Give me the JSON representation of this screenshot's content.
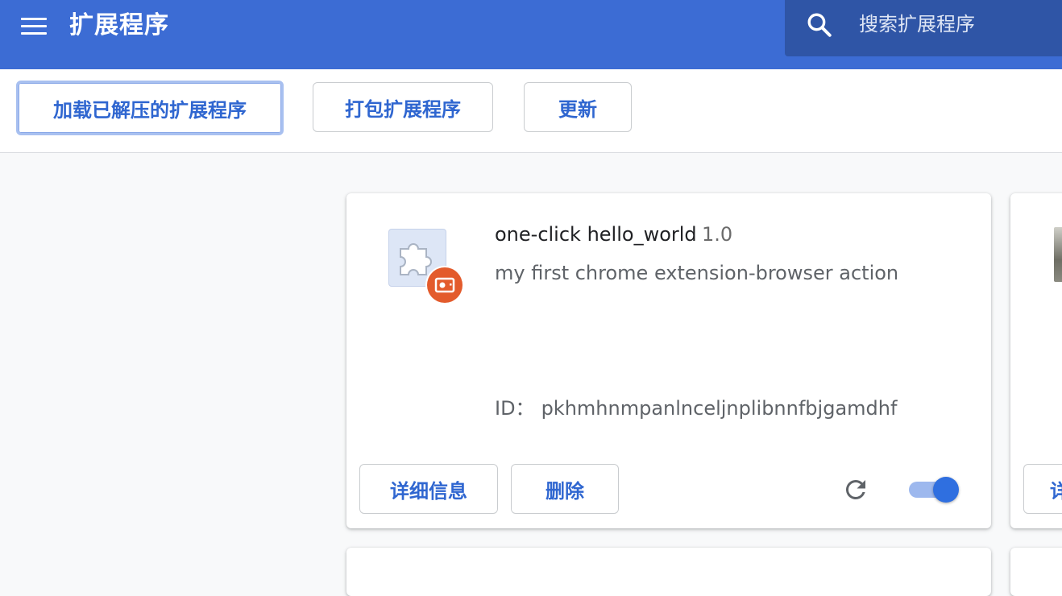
{
  "header": {
    "title": "扩展程序",
    "menu_icon": "hamburger-menu-icon",
    "search": {
      "icon": "search-icon",
      "placeholder": "搜索扩展程序",
      "value": ""
    },
    "colors": {
      "header_bg": "#3c6cd4",
      "search_bg": "#2f55a6"
    }
  },
  "toolbar": {
    "load_unpacked_label": "加载已解压的扩展程序",
    "pack_label": "打包扩展程序",
    "update_label": "更新"
  },
  "extension": {
    "name": "one-click hello_world",
    "version": "1.0",
    "description": "my first chrome extension-browser action",
    "id_label": "ID：",
    "id_value": "pkhmhnmpanlnceljnplibnnfbjgamdhf",
    "icon": "puzzle-piece-icon",
    "badge_icon": "unpacked-source-badge-icon",
    "details_label": "详细信息",
    "remove_label": "删除",
    "reload_icon": "reload-icon",
    "enabled": true,
    "colors": {
      "accent": "#2f66d0",
      "toggle_on": "#2f6fe0",
      "badge": "#e35b2c"
    }
  },
  "next_card": {
    "button_label_partial": "详"
  }
}
